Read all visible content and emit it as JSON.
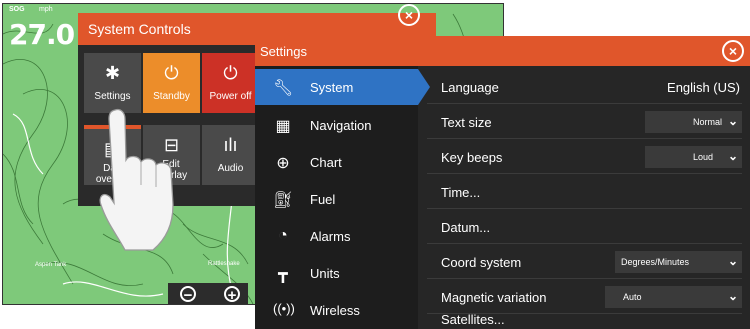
{
  "map": {
    "sog_label": "SOG",
    "unit_label": "mph",
    "speed_value": "27.0",
    "place_label_1": "Aspen Tank",
    "place_label_2": "Rattlesnake",
    "zoom_out_icon": "minus-circle-icon",
    "zoom_in_icon": "plus-circle-icon"
  },
  "system_controls": {
    "title": "System Controls",
    "tiles": [
      {
        "label": "Settings",
        "icon": "gear-icon",
        "color": "#4a4a4a"
      },
      {
        "label": "Standby",
        "icon": "power-icon",
        "color": "#ec8d2a"
      },
      {
        "label": "Power off",
        "icon": "power-icon",
        "color": "#cc3126"
      },
      {
        "label": "Day overlay",
        "icon": "overlay-icon",
        "color": "#4a4a4a"
      },
      {
        "label": "Edit overlay",
        "icon": "edit-overlay-icon",
        "color": "#4a4a4a"
      },
      {
        "label": "Audio",
        "icon": "audio-bars-icon",
        "color": "#4a4a4a"
      }
    ]
  },
  "settings": {
    "title": "Settings",
    "accent_color": "#e0562b",
    "selected_color": "#2f73c4",
    "sidebar": [
      {
        "label": "System",
        "icon": "wrench-icon",
        "active": true
      },
      {
        "label": "Navigation",
        "icon": "navigation-icon"
      },
      {
        "label": "Chart",
        "icon": "globe-icon"
      },
      {
        "label": "Fuel",
        "icon": "fuel-pump-icon"
      },
      {
        "label": "Alarms",
        "icon": "alarm-bell-icon"
      },
      {
        "label": "Units",
        "icon": "units-icon"
      },
      {
        "label": "Wireless",
        "icon": "wireless-icon"
      }
    ],
    "rows": [
      {
        "label": "Language",
        "value": "English (US)"
      },
      {
        "label": "Text size",
        "value": "Normal"
      },
      {
        "label": "Key beeps",
        "value": "Loud"
      },
      {
        "label": "Time..."
      },
      {
        "label": "Datum..."
      },
      {
        "label": "Coord system",
        "value": "Degrees/Minutes"
      },
      {
        "label": "Magnetic variation",
        "value": "Auto"
      },
      {
        "label": "Satellites..."
      }
    ]
  }
}
